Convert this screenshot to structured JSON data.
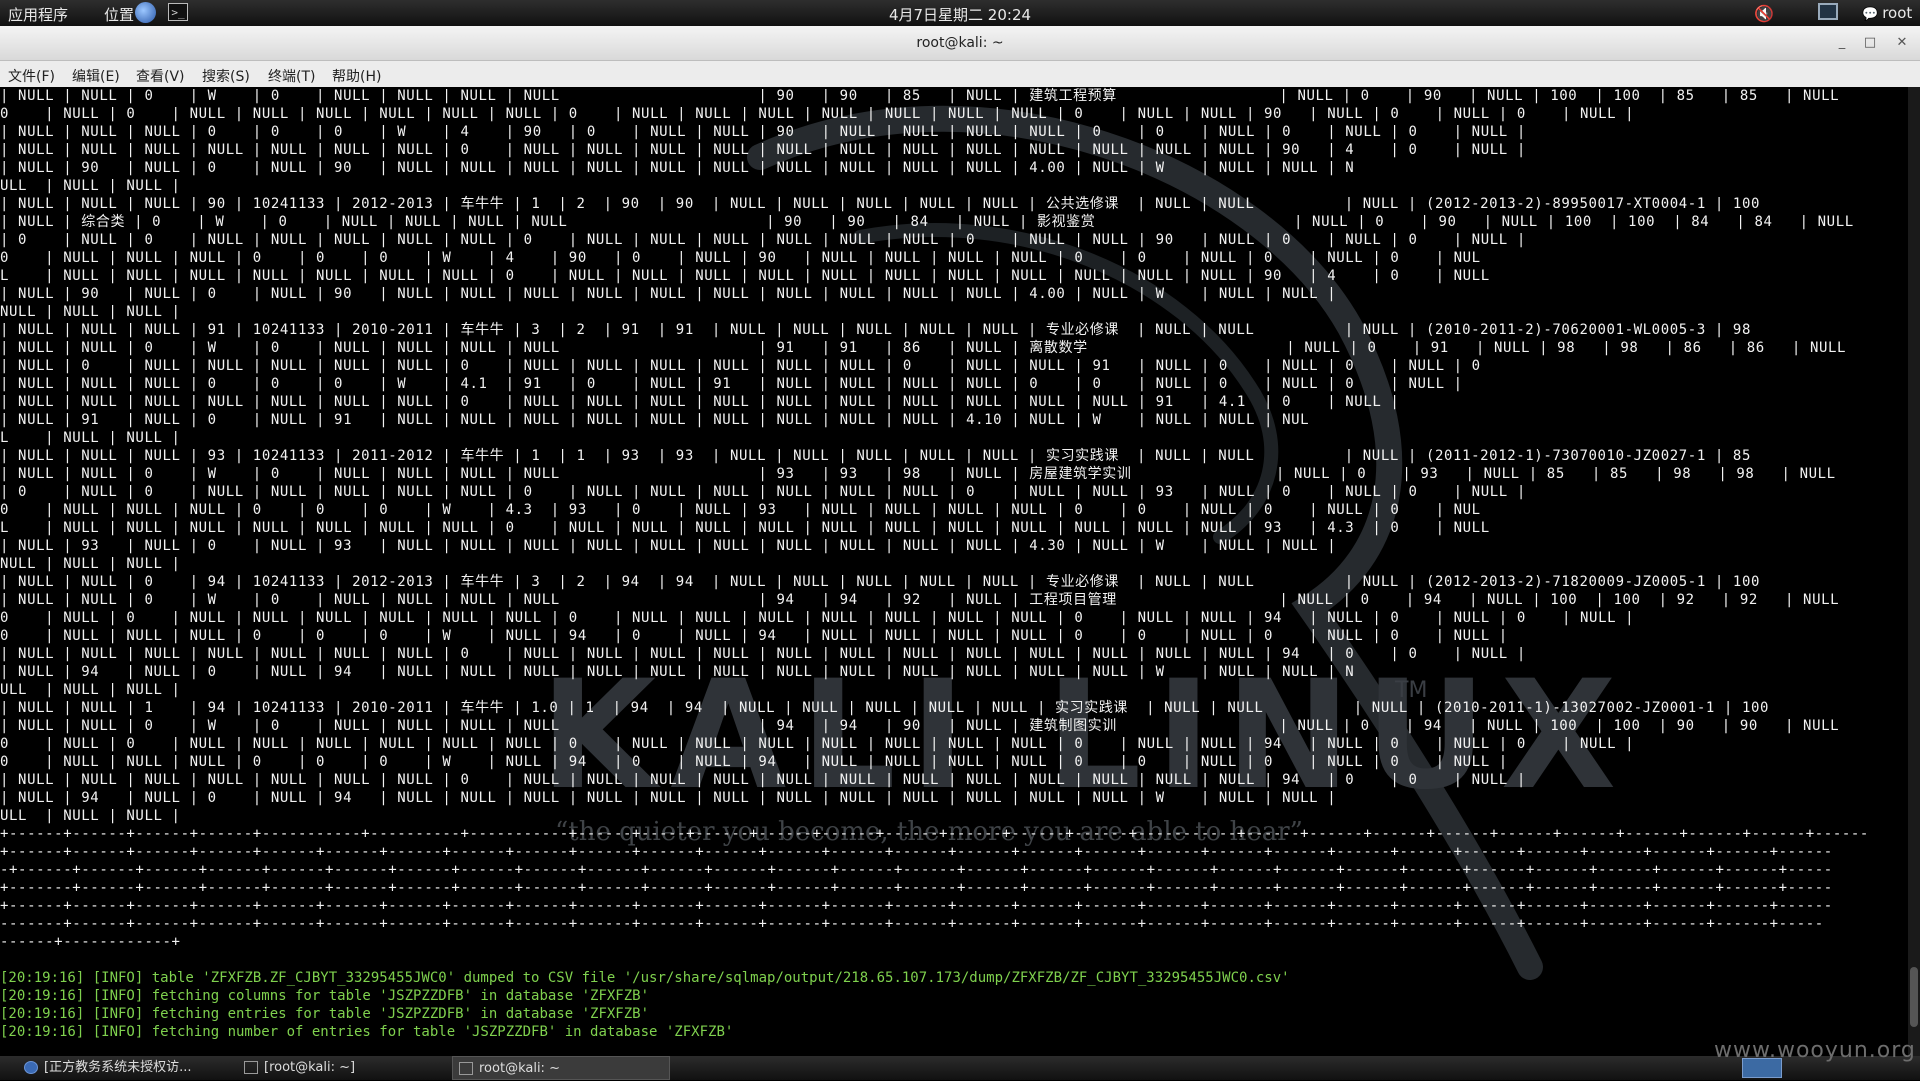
{
  "top_panel": {
    "apps_label": "应用程序",
    "places_label": "位置",
    "clock": "4月7日星期二 20:24",
    "user_label": "root"
  },
  "window": {
    "title": "root@kali: ~",
    "minimize": "_",
    "maximize": "□",
    "close": "✕"
  },
  "menu": {
    "file": "文件(F)",
    "edit": "编辑(E)",
    "view": "查看(V)",
    "search": "搜索(S)",
    "terminal": "终端(T)",
    "help": "帮助(H)"
  },
  "wallpaper": {
    "logo": "KALI LINUX",
    "tm": "TM",
    "tagline": "“the quieter you become, the more you are able to hear”"
  },
  "terminal_output": [
    "| NULL | NULL | 0    | W    | 0    | NULL | NULL | NULL | NULL                      | 90   | 90   | 85   | NULL | 建筑工程预算                  | NULL | 0    | 90   | NULL | 100  | 100  | 85   | 85   | NULL",
    "0    | NULL | 0    | NULL | NULL | NULL | NULL | NULL | NULL | 0    | NULL | NULL | NULL | NULL | NULL | NULL | NULL | 0    | NULL | NULL | 90   | NULL | 0    | NULL | 0    | NULL |",
    "| NULL | NULL | NULL | 0    | 0    | 0    | W    | 4    | 90   | 0    | NULL | NULL | 90   | NULL | NULL | NULL | NULL | 0    | 0    | NULL | 0    | NULL | 0    | NULL |",
    "| NULL | NULL | NULL | NULL | NULL | NULL | NULL | 0    | NULL | NULL | NULL | NULL | NULL | NULL | NULL | NULL | NULL | NULL | NULL | NULL | 90   | 4    | 0    | NULL |",
    "| NULL | 90   | NULL | 0    | NULL | 90   | NULL | NULL | NULL | NULL | NULL | NULL | NULL | NULL | NULL | NULL | 4.00 | NULL | W    | NULL | NULL | N",
    "ULL  | NULL | NULL |",
    "| NULL | NULL | NULL | 90 | 10241133 | 2012-2013 | 车牛牛 | 1  | 2  | 90  | 90  | NULL | NULL | NULL | NULL | NULL | 公共选修课  | NULL | NULL          | NULL | (2012-2013-2)-89950017-XT0004-1 | 100",
    "| NULL | 综合类 | 0    | W    | 0    | NULL | NULL | NULL | NULL                      | 90   | 90   | 84   | NULL | 影视鉴赏                      | NULL | 0    | 90   | NULL | 100  | 100  | 84   | 84   | NULL",
    "| 0    | NULL | 0    | NULL | NULL | NULL | NULL | NULL | 0    | NULL | NULL | NULL | NULL | NULL | NULL | 0    | NULL | NULL | 90   | NULL | 0    | NULL | 0    | NULL |",
    "0    | NULL | NULL | NULL | 0    | 0    | 0    | W    | 4    | 90   | 0    | NULL | 90   | NULL | NULL | NULL | NULL | 0    | 0    | NULL | 0    | NULL | 0    | NUL",
    "L    | NULL | NULL | NULL | NULL | NULL | NULL | NULL | 0    | NULL | NULL | NULL | NULL | NULL | NULL | NULL | NULL | NULL | NULL | NULL | 90   | 4    | 0    | NULL",
    "| NULL | 90   | NULL | 0    | NULL | 90   | NULL | NULL | NULL | NULL | NULL | NULL | NULL | NULL | NULL | NULL | 4.00 | NULL | W    | NULL | NULL |",
    "NULL | NULL | NULL |",
    "| NULL | NULL | NULL | 91 | 10241133 | 2010-2011 | 车牛牛 | 3  | 2  | 91  | 91  | NULL | NULL | NULL | NULL | NULL | 专业必修课  | NULL | NULL          | NULL | (2010-2011-2)-70620001-WL0005-3 | 98",
    "| NULL | NULL | 0    | W    | 0    | NULL | NULL | NULL | NULL                      | 91   | 91   | 86   | NULL | 离散数学                      | NULL | 0    | 91   | NULL | 98   | 98   | 86   | 86   | NULL",
    "| NULL | 0    | NULL | NULL | NULL | NULL | NULL | 0    | NULL | NULL | NULL | NULL | NULL | NULL | 0    | NULL | NULL | 91   | NULL | 0    | NULL | 0    | NULL | 0",
    "| NULL | NULL | NULL | 0    | 0    | 0    | W    | 4.1  | 91   | 0    | NULL | 91   | NULL | NULL | NULL | NULL | 0    | 0    | NULL | 0    | NULL | 0    | NULL |",
    "| NULL | NULL | NULL | NULL | NULL | NULL | NULL | 0    | NULL | NULL | NULL | NULL | NULL | NULL | NULL | NULL | NULL | NULL | 91   | 4.1  | 0    | NULL |",
    "| NULL | 91   | NULL | 0    | NULL | 91   | NULL | NULL | NULL | NULL | NULL | NULL | NULL | NULL | NULL | 4.10 | NULL | W    | NULL | NULL | NUL",
    "L    | NULL | NULL |",
    "| NULL | NULL | NULL | 93 | 10241133 | 2011-2012 | 车牛牛 | 1  | 1  | 93  | 93  | NULL | NULL | NULL | NULL | NULL | 实习实践课  | NULL | NULL          | NULL | (2011-2012-1)-73070010-JZ0027-1 | 85",
    "| NULL | NULL | 0    | W    | 0    | NULL | NULL | NULL | NULL                      | 93   | 93   | 98   | NULL | 房屋建筑学实训                | NULL | 0    | 93   | NULL | 85   | 85   | 98   | 98   | NULL",
    "| 0    | NULL | 0    | NULL | NULL | NULL | NULL | NULL | 0    | NULL | NULL | NULL | NULL | NULL | NULL | 0    | NULL | NULL | 93   | NULL | 0    | NULL | 0    | NULL |",
    "0    | NULL | NULL | NULL | 0    | 0    | 0    | W    | 4.3  | 93   | 0    | NULL | 93   | NULL | NULL | NULL | NULL | 0    | 0    | NULL | 0    | NULL | 0    | NUL",
    "L    | NULL | NULL | NULL | NULL | NULL | NULL | NULL | 0    | NULL | NULL | NULL | NULL | NULL | NULL | NULL | NULL | NULL | NULL | NULL | 93   | 4.3  | 0    | NULL",
    "| NULL | 93   | NULL | 0    | NULL | 93   | NULL | NULL | NULL | NULL | NULL | NULL | NULL | NULL | NULL | NULL | 4.30 | NULL | W    | NULL | NULL |",
    "NULL | NULL | NULL |",
    "| NULL | NULL | 0    | 94 | 10241133 | 2012-2013 | 车牛牛 | 3  | 2  | 94  | 94  | NULL | NULL | NULL | NULL | NULL | 专业必修课  | NULL | NULL          | NULL | (2012-2013-2)-71820009-JZ0005-1 | 100",
    "| NULL | NULL | 0    | W    | 0    | NULL | NULL | NULL | NULL                      | 94   | 94   | 92   | NULL | 工程项目管理                  | NULL | 0    | 94   | NULL | 100  | 100  | 92   | 92   | NULL",
    "0    | NULL | 0    | NULL | NULL | NULL | NULL | NULL | NULL | 0    | NULL | NULL | NULL | NULL | NULL | NULL | NULL | 0    | NULL | NULL | 94   | NULL | 0    | NULL | 0    | NULL |",
    "0    | NULL | NULL | NULL | 0    | 0    | 0    | W    | NULL | 94   | 0    | NULL | 94   | NULL | NULL | NULL | NULL | 0    | 0    | NULL | 0    | NULL | 0    | NULL |",
    "| NULL | NULL | NULL | NULL | NULL | NULL | NULL | 0    | NULL | NULL | NULL | NULL | NULL | NULL | NULL | NULL | NULL | NULL | NULL | NULL | 94   | 0    | 0    | NULL |",
    "| NULL | 94   | NULL | 0    | NULL | 94   | NULL | NULL | NULL | NULL | NULL | NULL | NULL | NULL | NULL | NULL | NULL | NULL | W    | NULL | NULL | N",
    "ULL  | NULL | NULL |",
    "| NULL | NULL | 1    | 94 | 10241133 | 2010-2011 | 车牛牛 | 1.0 | 1  | 94  | 94  | NULL | NULL | NULL | NULL | NULL | 实习实践课  | NULL | NULL          | NULL | (2010-2011-1)-13027002-JZ0001-1 | 100",
    "| NULL | NULL | 0    | W    | 0    | NULL | NULL | NULL | NULL                      | 94   | 94   | 90   | NULL | 建筑制图实训                  | NULL | 0    | 94   | NULL | 100  | 100  | 90   | 90   | NULL",
    "0    | NULL | 0    | NULL | NULL | NULL | NULL | NULL | NULL | 0    | NULL | NULL | NULL | NULL | NULL | NULL | NULL | 0    | NULL | NULL | 94   | NULL | 0    | NULL | 0    | NULL |",
    "0    | NULL | NULL | NULL | 0    | 0    | 0    | W    | NULL | 94   | 0    | NULL | 94   | NULL | NULL | NULL | NULL | 0    | 0    | NULL | 0    | NULL | 0    | NULL |",
    "| NULL | NULL | NULL | NULL | NULL | NULL | NULL | 0    | NULL | NULL | NULL | NULL | NULL | NULL | NULL | NULL | NULL | NULL | NULL | NULL | 94   | 0    | 0    | NULL |",
    "| NULL | 94   | NULL | 0    | NULL | 94   | NULL | NULL | NULL | NULL | NULL | NULL | NULL | NULL | NULL | NULL | NULL | NULL | W    | NULL | NULL |",
    "ULL  | NULL | NULL |",
    "+------+------+------+------+-----------+----------+-----------+------+-----+------+------+------+------+------+------+------+-----------+------+------+------+------+------+------+------+------+------+------",
    "+------+------+------+------+------+------+------+------+------+------+------+------+------+------+------+------+------+------+------+------+------+------+------+------+------+------+------+------+------",
    "-+------+------+------+------+------+------+------+------+------+------+------+------+------+------+------+------+------+------+------+------+------+------+------+------+------+------+------+------+-----",
    "+-------+------+------+------+------+------+------+------+------+------+------+------+------+------+------+------+------+------+------+------+------+------+------+------+------+------+------+------+-----",
    "+------+------+------+------+------+------+------+------+------+------+------+------+------+------+------+------+------+------+------+------+------+------+------+------+------+------+------+------+------",
    "-------+------+------+------+------+------+------+------+------+------+------+------+------+------+------+------+------+------+------+------+------+------+------+------+------+------+------+------+-----",
    "------+------------+"
  ],
  "log_lines": [
    "[20:19:16] [INFO] table 'ZFXFZB.ZF_CJBYT_33295455JWC0' dumped to CSV file '/usr/share/sqlmap/output/218.65.107.173/dump/ZFXFZB/ZF_CJBYT_33295455JWC0.csv'",
    "[20:19:16] [INFO] fetching columns for table 'JSZPZZDFB' in database 'ZFXFZB'",
    "[20:19:16] [INFO] fetching entries for table 'JSZPZZDFB' in database 'ZFXFZB'",
    "[20:19:16] [INFO] fetching number of entries for table 'JSZPZZDFB' in database 'ZFXFZB'"
  ],
  "taskbar": {
    "task1": "[正方教务系统未授权访...",
    "task2": "[root@kali: ~]",
    "task3": "root@kali: ~"
  },
  "watermark": "www.wooyun.org",
  "colors": {
    "log_green": "#7fd14e",
    "terminal_bg": "#000000",
    "wallpaper_logo": "#2f3338"
  },
  "icons": [
    "browser-icon",
    "terminal-icon",
    "volume-muted-icon",
    "network-icon",
    "chat-bubble-icon"
  ]
}
